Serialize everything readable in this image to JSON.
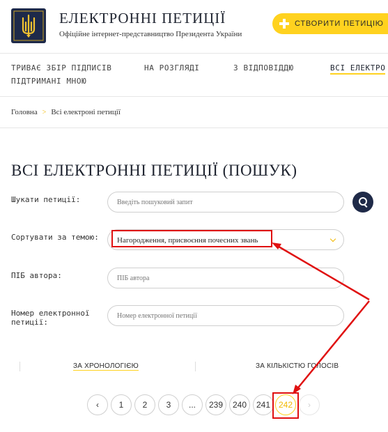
{
  "header": {
    "title": "ЕЛЕКТРОННІ ПЕТИЦІЇ",
    "subtitle": "Офіційне інтернет-представництво Президента України",
    "create_button": "СТВОРИТИ ПЕТИЦІЮ"
  },
  "nav": {
    "items": [
      "ТРИВАЄ ЗБІР ПІДПИСІВ",
      "НА РОЗГЛЯДІ",
      "З ВІДПОВІДДЮ",
      "ВСІ ЕЛЕКТРО"
    ],
    "second_row": "ПІДТРИМАНІ МНОЮ"
  },
  "breadcrumb": {
    "home": "Головна",
    "separator": ">",
    "current": "Всі електроні петиції"
  },
  "page_title": "ВСІ ЕЛЕКТРОННІ ПЕТИЦІЇ (ПОШУК)",
  "form": {
    "search_label": "Шукати петиції:",
    "search_placeholder": "Введіть пошуковий запит",
    "sort_label": "Сортувати за темою:",
    "sort_value": "Нагородження, присвоєння почесних звань",
    "author_label": "ПІБ автора:",
    "author_placeholder": "ПІБ автора",
    "number_label": "Номер електронної петиції:",
    "number_placeholder": "Номер електронної петиції"
  },
  "sort": {
    "chronology": "ЗА ХРОНОЛОГІЄЮ",
    "votes": "ЗА КІЛЬКІСТЮ ГОЛОСІВ"
  },
  "pagination": {
    "prev": "‹",
    "pages": [
      "1",
      "2",
      "3",
      "...",
      "239",
      "240",
      "241",
      "242"
    ],
    "current": "242",
    "next": "›"
  },
  "colors": {
    "accent_yellow": "#ffd21f",
    "navy": "#1f2a48",
    "annotation_red": "#e01010"
  }
}
